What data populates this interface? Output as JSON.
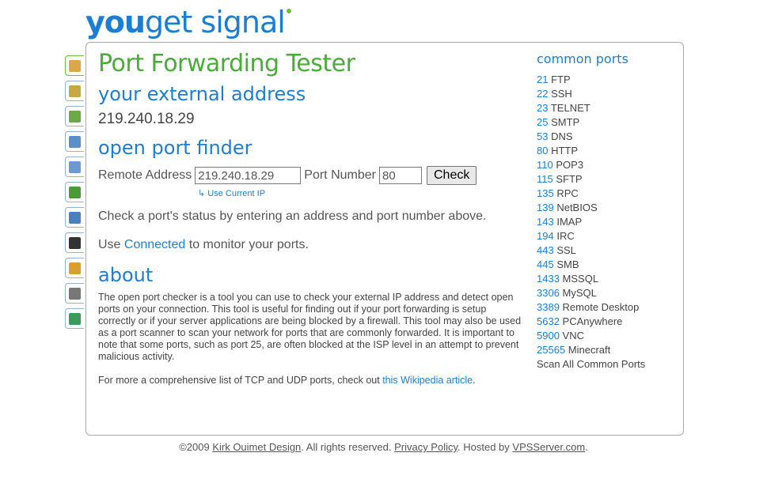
{
  "logo": {
    "you": "you",
    "rest": "get signal"
  },
  "tabs": [
    {
      "icon": "lock-icon",
      "color": "#d8a84a"
    },
    {
      "icon": "network-icon",
      "color": "#c8a840"
    },
    {
      "icon": "map-icon",
      "color": "#6aa84a"
    },
    {
      "icon": "phone-icon",
      "color": "#5a8fc8"
    },
    {
      "icon": "mail-icon",
      "color": "#6a9ad0"
    },
    {
      "icon": "tree-icon",
      "color": "#4a9a3a"
    },
    {
      "icon": "help-icon",
      "color": "#4a80c0"
    },
    {
      "icon": "google-icon",
      "color": "#333333"
    },
    {
      "icon": "windows-icon",
      "color": "#d8a030"
    },
    {
      "icon": "printer-icon",
      "color": "#777777"
    },
    {
      "icon": "globe-icon",
      "color": "#3a9a5a"
    }
  ],
  "main": {
    "title": "Port Forwarding Tester",
    "external_heading": "your external address",
    "external_ip": "219.240.18.29",
    "finder_heading": "open port finder",
    "remote_label": "Remote Address",
    "remote_value": "219.240.18.29",
    "port_label": "Port Number",
    "port_value": "80",
    "check_label": "Check",
    "use_current": "Use Current IP",
    "status_text": "Check a port's status by entering an address and port number above.",
    "use_prefix": "Use ",
    "connected_link": "Connected",
    "use_suffix": " to monitor your ports.",
    "about_heading": "about",
    "about_text": "The open port checker is a tool you can use to check your external IP address and detect open ports on your connection. This tool is useful for finding out if your port forwarding is setup correctly or if your server applications are being blocked by a firewall. This tool may also be used as a port scanner to scan your network for ports that are commonly forwarded. It is important to note that some ports, such as port 25, are often blocked at the ISP level in an attempt to prevent malicious activity.",
    "more_prefix": "For more a comprehensive list of TCP and UDP ports, check out ",
    "wiki_link": "this Wikipedia article",
    "more_suffix": "."
  },
  "sidebar": {
    "heading": "common ports",
    "ports": [
      {
        "num": "21",
        "name": "FTP"
      },
      {
        "num": "22",
        "name": "SSH"
      },
      {
        "num": "23",
        "name": "TELNET"
      },
      {
        "num": "25",
        "name": "SMTP"
      },
      {
        "num": "53",
        "name": "DNS"
      },
      {
        "num": "80",
        "name": "HTTP"
      },
      {
        "num": "110",
        "name": "POP3"
      },
      {
        "num": "115",
        "name": "SFTP"
      },
      {
        "num": "135",
        "name": "RPC"
      },
      {
        "num": "139",
        "name": "NetBIOS"
      },
      {
        "num": "143",
        "name": "IMAP"
      },
      {
        "num": "194",
        "name": "IRC"
      },
      {
        "num": "443",
        "name": "SSL"
      },
      {
        "num": "445",
        "name": "SMB"
      },
      {
        "num": "1433",
        "name": "MSSQL"
      },
      {
        "num": "3306",
        "name": "MySQL"
      },
      {
        "num": "3389",
        "name": "Remote Desktop"
      },
      {
        "num": "5632",
        "name": "PCAnywhere"
      },
      {
        "num": "5900",
        "name": "VNC"
      },
      {
        "num": "25565",
        "name": "Minecraft"
      }
    ],
    "scan_all": "Scan All Common Ports"
  },
  "footer": {
    "copyright": "©2009 ",
    "company": "Kirk Ouimet Design",
    "rights": ". All rights reserved. ",
    "privacy": "Privacy Policy",
    "hosted": ". Hosted by ",
    "host": "VPSServer.com",
    "end": "."
  }
}
